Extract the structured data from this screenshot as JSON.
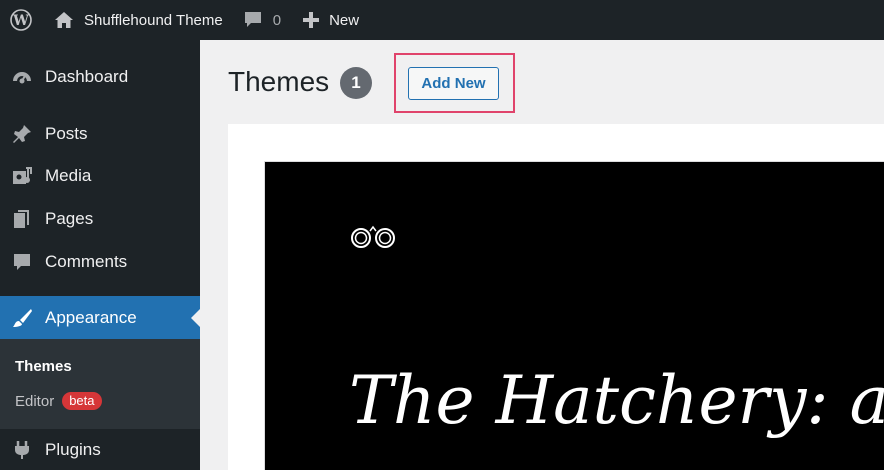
{
  "admin_bar": {
    "site_name": "Shufflehound Theme",
    "comments_count": "0",
    "new_label": "New"
  },
  "sidebar": {
    "items": [
      {
        "label": "Dashboard",
        "icon": "dashboard-icon"
      },
      {
        "label": "Posts",
        "icon": "pushpin-icon"
      },
      {
        "label": "Media",
        "icon": "media-icon"
      },
      {
        "label": "Pages",
        "icon": "pages-icon"
      },
      {
        "label": "Comments",
        "icon": "comment-icon"
      },
      {
        "label": "Appearance",
        "icon": "paintbrush-icon",
        "active": true
      },
      {
        "label": "Plugins",
        "icon": "plugin-icon"
      }
    ],
    "submenu": [
      {
        "label": "Themes",
        "current": true
      },
      {
        "label": "Editor",
        "badge": "beta"
      }
    ]
  },
  "main": {
    "title": "Themes",
    "count": "1",
    "add_new_label": "Add New",
    "theme_preview_heading": "The Hatchery: a"
  },
  "colors": {
    "admin_dark": "#1d2327",
    "active_blue": "#2271b1",
    "highlight_pink": "#e0436b",
    "beta_red": "#d63638"
  }
}
